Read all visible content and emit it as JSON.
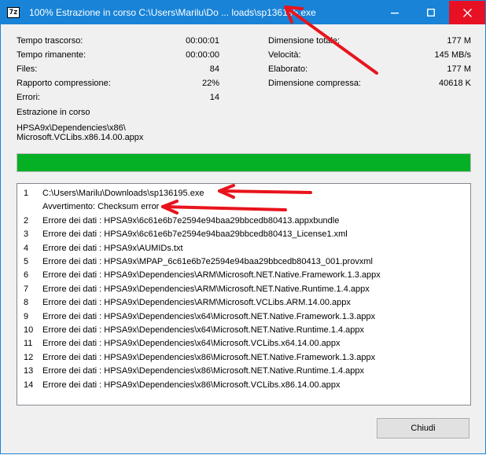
{
  "window": {
    "icon_text": "7z",
    "title": "100% Estrazione in corso C:\\Users\\Marilu\\Do ... loads\\sp136195.exe",
    "controls": {
      "minimize": "minimize-icon",
      "maximize": "maximize-icon",
      "close": "close-icon"
    }
  },
  "stats_left": [
    {
      "label": "Tempo trascorso:",
      "value": "00:00:01"
    },
    {
      "label": "Tempo rimanente:",
      "value": "00:00:00"
    },
    {
      "label": "Files:",
      "value": "84"
    },
    {
      "label": "Rapporto compressione:",
      "value": "22%"
    },
    {
      "label": "Errori:",
      "value": "14"
    }
  ],
  "stats_right": [
    {
      "label": "Dimensione totale:",
      "value": "177 M"
    },
    {
      "label": "Velocità:",
      "value": "145 MB/s"
    },
    {
      "label": "Elaborato:",
      "value": "177 M"
    },
    {
      "label": "Dimensione compressa:",
      "value": "40618 K"
    }
  ],
  "status": {
    "heading": "Estrazione in corso",
    "path_line1": "HPSA9x\\Dependencies\\x86\\",
    "path_line2": "Microsoft.VCLibs.x86.14.00.appx"
  },
  "progress": {
    "percent": 100,
    "color": "#06b025"
  },
  "log": [
    {
      "num": "1",
      "msg": "C:\\Users\\Marilu\\Downloads\\sp136195.exe"
    },
    {
      "num": "",
      "msg": "Avvertimento: Checksum error"
    },
    {
      "num": "2",
      "msg": "Errore dei dati : HPSA9x\\6c61e6b7e2594e94baa29bbcedb80413.appxbundle"
    },
    {
      "num": "3",
      "msg": "Errore dei dati : HPSA9x\\6c61e6b7e2594e94baa29bbcedb80413_License1.xml"
    },
    {
      "num": "4",
      "msg": "Errore dei dati : HPSA9x\\AUMIDs.txt"
    },
    {
      "num": "5",
      "msg": "Errore dei dati : HPSA9x\\MPAP_6c61e6b7e2594e94baa29bbcedb80413_001.provxml"
    },
    {
      "num": "6",
      "msg": "Errore dei dati : HPSA9x\\Dependencies\\ARM\\Microsoft.NET.Native.Framework.1.3.appx"
    },
    {
      "num": "7",
      "msg": "Errore dei dati : HPSA9x\\Dependencies\\ARM\\Microsoft.NET.Native.Runtime.1.4.appx"
    },
    {
      "num": "8",
      "msg": "Errore dei dati : HPSA9x\\Dependencies\\ARM\\Microsoft.VCLibs.ARM.14.00.appx"
    },
    {
      "num": "9",
      "msg": "Errore dei dati : HPSA9x\\Dependencies\\x64\\Microsoft.NET.Native.Framework.1.3.appx"
    },
    {
      "num": "10",
      "msg": "Errore dei dati : HPSA9x\\Dependencies\\x64\\Microsoft.NET.Native.Runtime.1.4.appx"
    },
    {
      "num": "11",
      "msg": "Errore dei dati : HPSA9x\\Dependencies\\x64\\Microsoft.VCLibs.x64.14.00.appx"
    },
    {
      "num": "12",
      "msg": "Errore dei dati : HPSA9x\\Dependencies\\x86\\Microsoft.NET.Native.Framework.1.3.appx"
    },
    {
      "num": "13",
      "msg": "Errore dei dati : HPSA9x\\Dependencies\\x86\\Microsoft.NET.Native.Runtime.1.4.appx"
    },
    {
      "num": "14",
      "msg": "Errore dei dati : HPSA9x\\Dependencies\\x86\\Microsoft.VCLibs.x86.14.00.appx"
    }
  ],
  "buttons": {
    "close_label": "Chiudi"
  },
  "annotations": {
    "arrow_color": "#e8141c",
    "arrow_count": 3
  },
  "colors": {
    "titlebar": "#1883d7",
    "close_hover": "#e81123",
    "progress": "#06b025"
  }
}
